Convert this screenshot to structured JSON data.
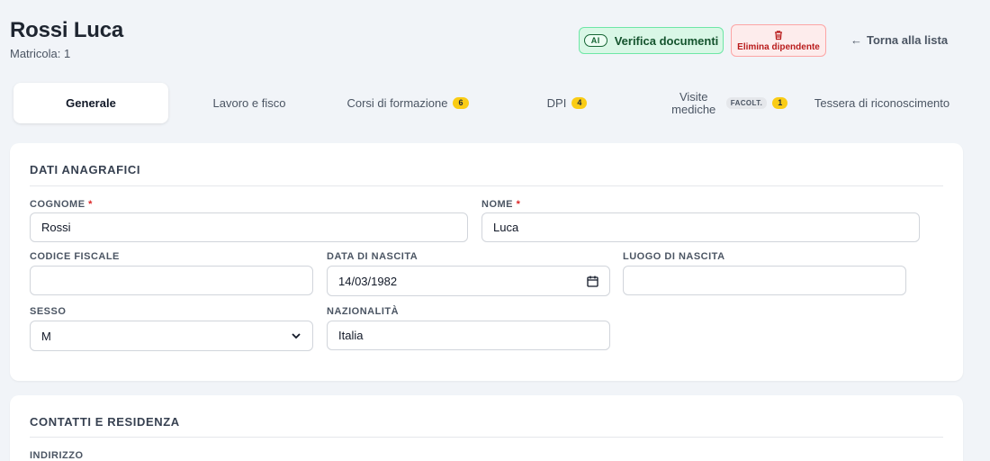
{
  "header": {
    "name": "Rossi Luca",
    "matricola": "Matricola: 1",
    "ai_badge": "AI",
    "verify_label": "Verifica documenti",
    "delete_label": "Elimina dipendente",
    "back_arrow": "←",
    "back_label": "Torna alla lista"
  },
  "tabs": [
    {
      "label": "Generale",
      "active": true
    },
    {
      "label": "Lavoro e fisco"
    },
    {
      "label": "Corsi di formazione",
      "badge": "6"
    },
    {
      "label": "DPI",
      "badge": "4"
    },
    {
      "label": "Visite mediche",
      "tag": "FACOLT.",
      "badge": "1"
    },
    {
      "label": "Tessera di riconoscimento"
    }
  ],
  "anagrafici": {
    "title": "DATI ANAGRAFICI",
    "cognome": {
      "label": "COGNOME",
      "required": "*",
      "value": "Rossi"
    },
    "nome": {
      "label": "NOME",
      "required": "*",
      "value": "Luca"
    },
    "codice_fiscale": {
      "label": "CODICE FISCALE",
      "value": ""
    },
    "data_nascita": {
      "label": "DATA DI NASCITA",
      "value": "14/03/1982"
    },
    "luogo_nascita": {
      "label": "LUOGO DI NASCITA",
      "value": ""
    },
    "sesso": {
      "label": "SESSO",
      "value": "M"
    },
    "nazionalita": {
      "label": "NAZIONALITÀ",
      "value": "Italia"
    }
  },
  "contatti": {
    "title": "CONTATTI E RESIDENZA",
    "indirizzo_label": "INDIRIZZO"
  },
  "colors": {
    "accent_green": "#d9f7e6",
    "danger_red": "#b91c1c",
    "badge_yellow": "#facc15"
  }
}
